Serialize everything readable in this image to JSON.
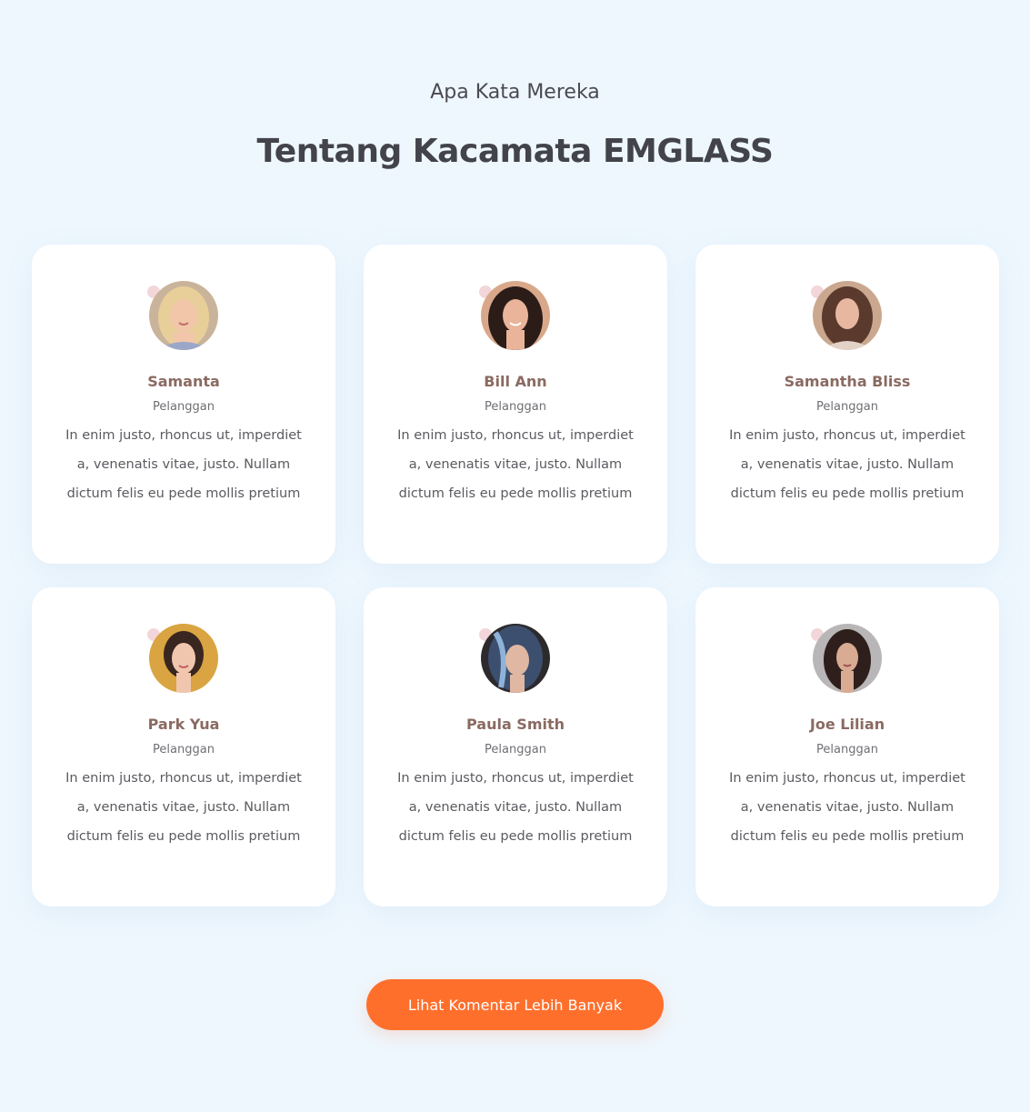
{
  "header": {
    "subtitle": "Apa Kata Mereka",
    "title": "Tentang Kacamata EMGLASS"
  },
  "testimonials": [
    {
      "name": "Samanta",
      "role": "Pelanggan",
      "quote": "In enim justo, rhoncus ut, imperdiet a, venenatis vitae, justo. Nullam dictum felis eu pede mollis pretium",
      "avatar": "woman-blonde-portrait"
    },
    {
      "name": "Bill Ann",
      "role": "Pelanggan",
      "quote": "In enim justo, rhoncus ut, imperdiet a, venenatis vitae, justo. Nullam dictum felis eu pede mollis pretium",
      "avatar": "woman-dark-hair-portrait"
    },
    {
      "name": "Samantha Bliss",
      "role": "Pelanggan",
      "quote": "In enim justo, rhoncus ut, imperdiet a, venenatis vitae, justo. Nullam dictum felis eu pede mollis pretium",
      "avatar": "woman-brown-hair-portrait"
    },
    {
      "name": "Park Yua",
      "role": "Pelanggan",
      "quote": "In enim justo, rhoncus ut, imperdiet a, venenatis vitae, justo. Nullam dictum felis eu pede mollis pretium",
      "avatar": "woman-yellow-background-portrait"
    },
    {
      "name": "Paula Smith",
      "role": "Pelanggan",
      "quote": "In enim justo, rhoncus ut, imperdiet a, venenatis vitae, justo. Nullam dictum felis eu pede mollis pretium",
      "avatar": "woman-blue-hair-portrait"
    },
    {
      "name": "Joe Lilian",
      "role": "Pelanggan",
      "quote": "In enim justo, rhoncus ut, imperdiet a, venenatis vitae, justo. Nullam dictum felis eu pede mollis pretium",
      "avatar": "woman-grey-background-portrait"
    }
  ],
  "cta": {
    "label": "Lihat Komentar Lebih Banyak"
  },
  "colors": {
    "background": "#eef7fe",
    "card": "#ffffff",
    "accent": "#ff6f2c",
    "name": "#8a6a62",
    "heading": "#43434b"
  }
}
